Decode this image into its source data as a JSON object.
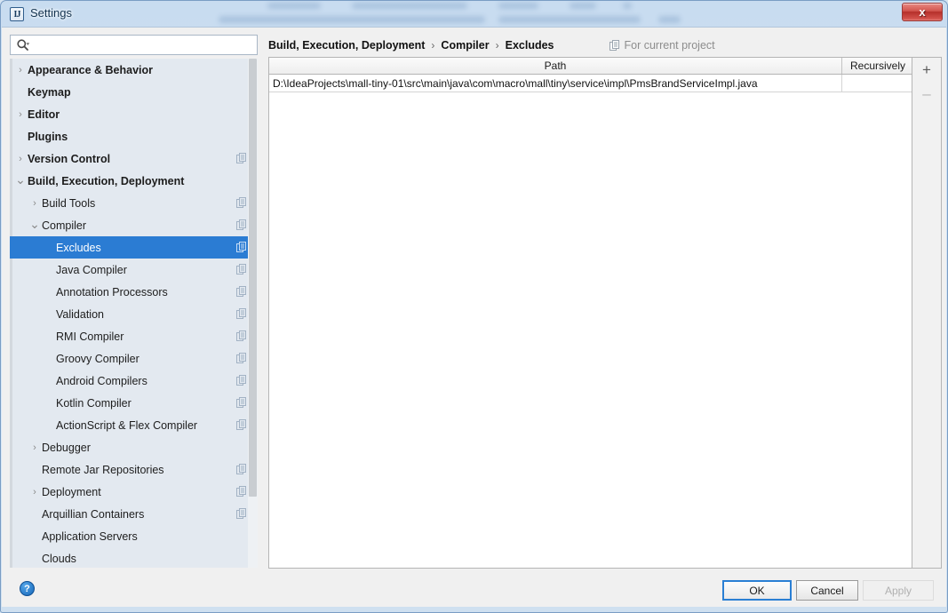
{
  "window": {
    "title": "Settings",
    "app_icon": "intellij-idea-icon",
    "close_label": "✕"
  },
  "search": {
    "value": "",
    "placeholder": "",
    "icon": "search-icon"
  },
  "sidebar": {
    "items": [
      {
        "label": "Appearance & Behavior",
        "depth": 0,
        "arrow": "collapsed",
        "bold": true,
        "project_icon": false,
        "selected": false
      },
      {
        "label": "Keymap",
        "depth": 0,
        "arrow": "none",
        "bold": true,
        "project_icon": false,
        "selected": false
      },
      {
        "label": "Editor",
        "depth": 0,
        "arrow": "collapsed",
        "bold": true,
        "project_icon": false,
        "selected": false
      },
      {
        "label": "Plugins",
        "depth": 0,
        "arrow": "none",
        "bold": true,
        "project_icon": false,
        "selected": false
      },
      {
        "label": "Version Control",
        "depth": 0,
        "arrow": "collapsed",
        "bold": true,
        "project_icon": true,
        "selected": false
      },
      {
        "label": "Build, Execution, Deployment",
        "depth": 0,
        "arrow": "expanded",
        "bold": true,
        "project_icon": false,
        "selected": false
      },
      {
        "label": "Build Tools",
        "depth": 1,
        "arrow": "collapsed",
        "bold": false,
        "project_icon": true,
        "selected": false
      },
      {
        "label": "Compiler",
        "depth": 1,
        "arrow": "expanded",
        "bold": false,
        "project_icon": true,
        "selected": false
      },
      {
        "label": "Excludes",
        "depth": 2,
        "arrow": "none",
        "bold": false,
        "project_icon": true,
        "selected": true
      },
      {
        "label": "Java Compiler",
        "depth": 2,
        "arrow": "none",
        "bold": false,
        "project_icon": true,
        "selected": false
      },
      {
        "label": "Annotation Processors",
        "depth": 2,
        "arrow": "none",
        "bold": false,
        "project_icon": true,
        "selected": false
      },
      {
        "label": "Validation",
        "depth": 2,
        "arrow": "none",
        "bold": false,
        "project_icon": true,
        "selected": false
      },
      {
        "label": "RMI Compiler",
        "depth": 2,
        "arrow": "none",
        "bold": false,
        "project_icon": true,
        "selected": false
      },
      {
        "label": "Groovy Compiler",
        "depth": 2,
        "arrow": "none",
        "bold": false,
        "project_icon": true,
        "selected": false
      },
      {
        "label": "Android Compilers",
        "depth": 2,
        "arrow": "none",
        "bold": false,
        "project_icon": true,
        "selected": false
      },
      {
        "label": "Kotlin Compiler",
        "depth": 2,
        "arrow": "none",
        "bold": false,
        "project_icon": true,
        "selected": false
      },
      {
        "label": "ActionScript & Flex Compiler",
        "depth": 2,
        "arrow": "none",
        "bold": false,
        "project_icon": true,
        "selected": false
      },
      {
        "label": "Debugger",
        "depth": 1,
        "arrow": "collapsed",
        "bold": false,
        "project_icon": false,
        "selected": false
      },
      {
        "label": "Remote Jar Repositories",
        "depth": 1,
        "arrow": "none",
        "bold": false,
        "project_icon": true,
        "selected": false
      },
      {
        "label": "Deployment",
        "depth": 1,
        "arrow": "collapsed",
        "bold": false,
        "project_icon": true,
        "selected": false
      },
      {
        "label": "Arquillian Containers",
        "depth": 1,
        "arrow": "none",
        "bold": false,
        "project_icon": true,
        "selected": false
      },
      {
        "label": "Application Servers",
        "depth": 1,
        "arrow": "none",
        "bold": false,
        "project_icon": false,
        "selected": false
      },
      {
        "label": "Clouds",
        "depth": 1,
        "arrow": "none",
        "bold": false,
        "project_icon": false,
        "selected": false
      }
    ]
  },
  "breadcrumb": {
    "items": [
      "Build, Execution, Deployment",
      "Compiler",
      "Excludes"
    ],
    "separator": "›",
    "scope_label": "For current project",
    "scope_icon": "project-scope-icon"
  },
  "table": {
    "columns": [
      "Path",
      "Recursively"
    ],
    "rows": [
      {
        "path": "D:\\IdeaProjects\\mall-tiny-01\\src\\main\\java\\com\\macro\\mall\\tiny\\service\\impl\\PmsBrandServiceImpl.java",
        "recursively": ""
      }
    ]
  },
  "toolbar": {
    "add_label": "+",
    "remove_label": "–"
  },
  "footer": {
    "help_label": "?",
    "ok_label": "OK",
    "cancel_label": "Cancel",
    "apply_label": "Apply"
  },
  "colors": {
    "selection_blue": "#2b7cd3",
    "focus_blue": "#2a7fd4",
    "sidebar_bg": "#e3e9f0",
    "title_glass": "#cfe1f4"
  }
}
